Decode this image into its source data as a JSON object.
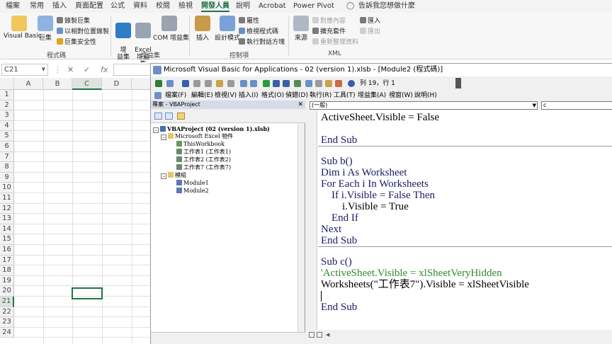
{
  "ribbon_tabs": [
    "檔案",
    "常用",
    "插入",
    "頁面配置",
    "公式",
    "資料",
    "校閱",
    "檢視",
    "開發人員",
    "說明",
    "Acrobat",
    "Power Pivot",
    "告訴我您想做什麼"
  ],
  "ribbon": {
    "code_group": {
      "label": "程式碼",
      "visual_basic": "Visual Basic",
      "macros": "巨集",
      "record": "錄製巨集",
      "relative": "以相對位置錄製",
      "security": "巨集安全性"
    },
    "addins_group": {
      "label": "增益集",
      "addins": "增\n益集",
      "excel_addins": "Excel\n增益集",
      "com_addins": "COM 增益集"
    },
    "controls_group": {
      "label": "控制項",
      "insert": "插入",
      "design": "設計模式",
      "properties": "屬性",
      "view_code": "檢視程式碼",
      "run_dialog": "執行對話方塊"
    },
    "xml_group": {
      "label": "XML",
      "source": "來源",
      "map_props": "對應內容",
      "expansion": "擴充套件",
      "refresh": "重新整理資料",
      "import": "匯入",
      "export": "匯出"
    }
  },
  "formula_bar": {
    "name_box": "C21",
    "fx": "fx"
  },
  "grid": {
    "columns": [
      "A",
      "B",
      "C",
      "D"
    ],
    "rows": [
      "1",
      "2",
      "3",
      "4",
      "5",
      "6",
      "7",
      "8",
      "9",
      "10",
      "11",
      "12",
      "13",
      "14",
      "15",
      "16",
      "17",
      "18",
      "19",
      "20",
      "21",
      "22",
      "23",
      "24"
    ]
  },
  "vbe": {
    "title": "Microsoft Visual Basic for Applications - 02 (version 1).xlsb - [Module2 (程式碼)]",
    "position": "列 19，行 1",
    "menu": [
      "檔案(F)",
      "編輯(E)",
      "檢視(V)",
      "插入(I)",
      "格式(O)",
      "偵錯(D)",
      "執行(R)",
      "工具(T)",
      "增益集(A)",
      "視窗(W)",
      "說明(H)"
    ],
    "project_title": "專案 - VBAProject",
    "tree": [
      {
        "label": "VBAProject (02 (version 1).xlsb)"
      },
      {
        "label": "Microsoft Excel 物件"
      },
      {
        "label": "ThisWorkbook"
      },
      {
        "label": "工作表1 (工作表1)"
      },
      {
        "label": "工作表2 (工作表2)"
      },
      {
        "label": "工作表7 (工作表7)"
      },
      {
        "label": "模組"
      },
      {
        "label": "Module1"
      },
      {
        "label": "Module2"
      }
    ],
    "combo_object": "(一般)",
    "combo_proc": "c",
    "code": [
      {
        "t": "ActiveSheet.Visible = False",
        "c": "black"
      },
      {
        "t": "",
        "c": "black"
      },
      {
        "t": "End Sub",
        "c": "blue"
      },
      {
        "t": "Sub b()",
        "c": "blue"
      },
      {
        "t": "Dim i As Worksheet",
        "c": "blue"
      },
      {
        "t": "For Each i In Worksheets",
        "c": "blue"
      },
      {
        "t": "    If i.Visible = False Then",
        "c": "blue"
      },
      {
        "t": "        i.Visible = True",
        "c": "black"
      },
      {
        "t": "    End If",
        "c": "blue"
      },
      {
        "t": "Next",
        "c": "blue"
      },
      {
        "t": "End Sub",
        "c": "blue"
      },
      {
        "t": "Sub c()",
        "c": "blue"
      },
      {
        "t": "'ActiveSheet.Visible = xlSheetVeryHidden",
        "c": "green"
      },
      {
        "t": "Worksheets(\"工作表7\").Visible = xlSheetVisible",
        "c": "black"
      },
      {
        "t": "",
        "c": "black"
      },
      {
        "t": "End Sub",
        "c": "blue"
      }
    ]
  },
  "colors": {
    "excel_green": "#217346",
    "selection": "#217346"
  }
}
